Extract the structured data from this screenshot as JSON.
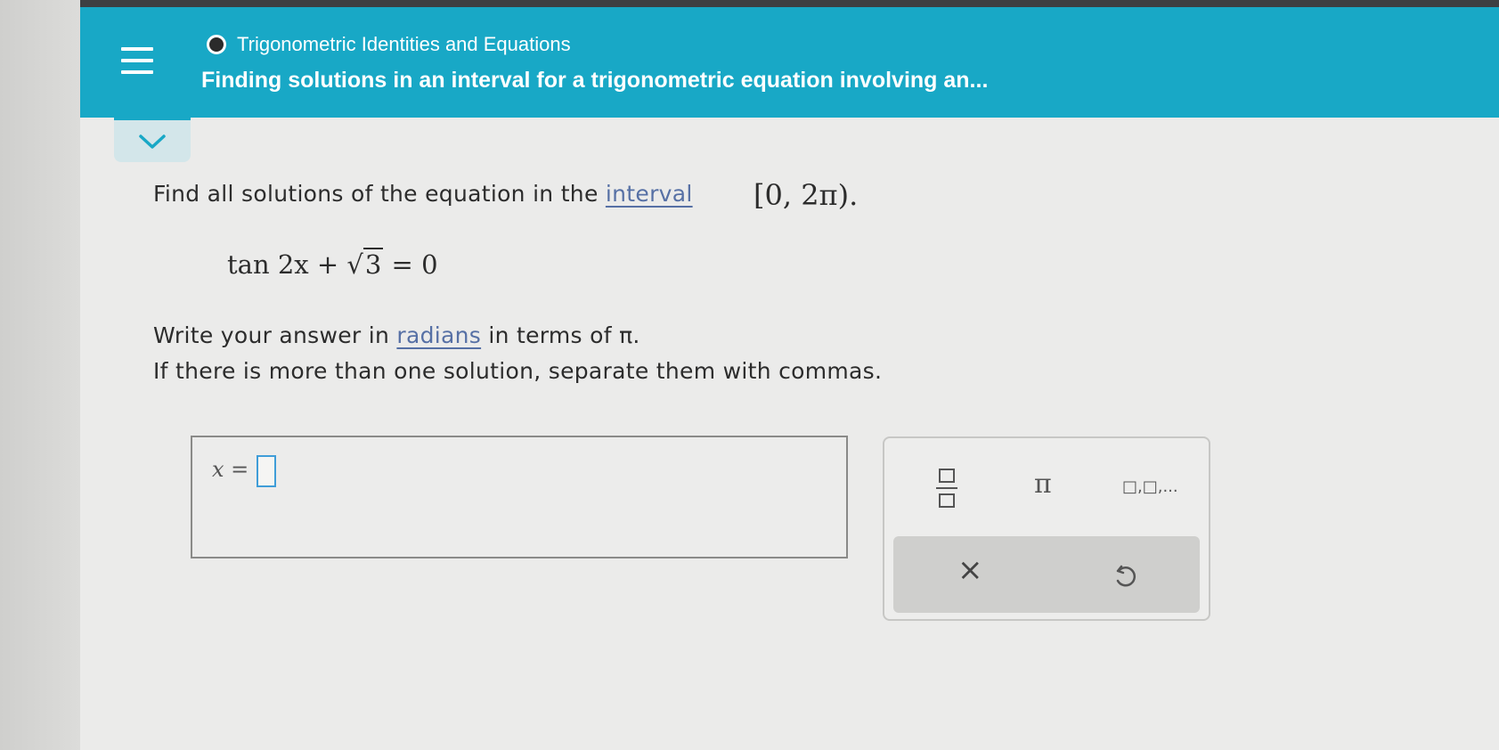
{
  "header": {
    "topic": "Trigonometric Identities and Equations",
    "problem_title": "Finding solutions in an interval for a trigonometric equation involving an..."
  },
  "question": {
    "prompt": "Find all solutions of the equation in the ",
    "interval_link": "interval",
    "interval": "[0, 2π).",
    "equation": {
      "left": "tan 2x + ",
      "radicand": "3",
      "right": " = 0"
    },
    "instruction_prefix": "Write your answer in ",
    "radians_link": "radians",
    "instruction_suffix": " in terms of π.",
    "instruction2": "If there is more than one solution, separate them with commas."
  },
  "answer": {
    "variable": "x =",
    "value": ""
  },
  "toolbar": {
    "pi": "π",
    "list": "□,□,...",
    "clear": "×"
  },
  "colors": {
    "header_bg": "#18a8c6",
    "link": "#5670a5",
    "input_border": "#3f9dd8"
  },
  "icons": [
    "menu-icon",
    "chevron-down-icon",
    "fraction-icon",
    "pi-icon",
    "list-icon",
    "clear-icon",
    "undo-icon"
  ]
}
